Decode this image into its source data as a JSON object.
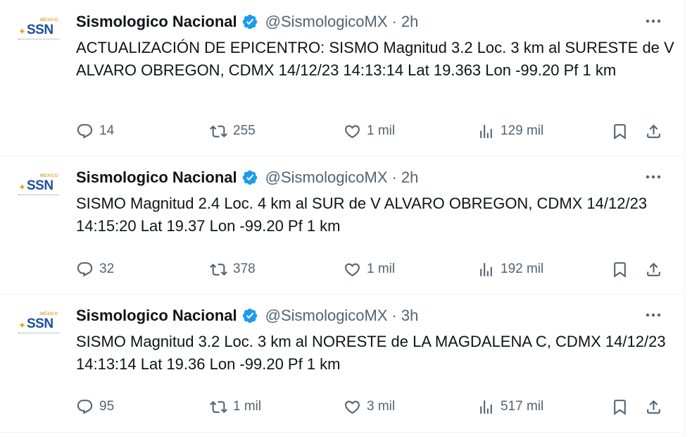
{
  "tweets": [
    {
      "author_name": "Sismologico Nacional",
      "handle": "@SismologicoMX",
      "separator": "·",
      "time": "2h",
      "text": "ACTUALIZACIÓN DE EPICENTRO: SISMO Magnitud 3.2 Loc. 3 km al SURESTE de V ALVARO OBREGON, CDMX 14/12/23 14:13:14 Lat 19.363 Lon -99.20 Pf 1 km",
      "replies": "14",
      "reposts": "255",
      "likes": "1 mil",
      "views": "129 mil"
    },
    {
      "author_name": "Sismologico Nacional",
      "handle": "@SismologicoMX",
      "separator": "·",
      "time": "2h",
      "text": "SISMO Magnitud 2.4 Loc. 4 km al SUR de V ALVARO OBREGON, CDMX 14/12/23 14:15:20 Lat 19.37 Lon -99.20 Pf 1 km",
      "replies": "32",
      "reposts": "378",
      "likes": "1 mil",
      "views": "192 mil"
    },
    {
      "author_name": "Sismologico Nacional",
      "handle": "@SismologicoMX",
      "separator": "·",
      "time": "3h",
      "text": "SISMO Magnitud 3.2 Loc. 3 km al NORESTE de LA MAGDALENA C, CDMX 14/12/23 14:13:14 Lat 19.36 Lon -99.20 Pf 1 km",
      "replies": "95",
      "reposts": "1 mil",
      "likes": "3 mil",
      "views": "517 mil"
    }
  ],
  "avatar": {
    "logo_text": "SSN",
    "logo_small": "MÉXICO"
  },
  "icons": {
    "verified": "verified-badge-icon",
    "more": "more-icon",
    "reply": "reply-icon",
    "repost": "repost-icon",
    "like": "heart-icon",
    "views": "views-icon",
    "bookmark": "bookmark-icon",
    "share": "share-icon"
  },
  "colors": {
    "verified": "#1d9bf0",
    "text": "#0f1419",
    "muted": "#536471",
    "divider": "#eff3f4",
    "logo_blue": "#1c4f9c",
    "logo_gold": "#e8a317"
  }
}
